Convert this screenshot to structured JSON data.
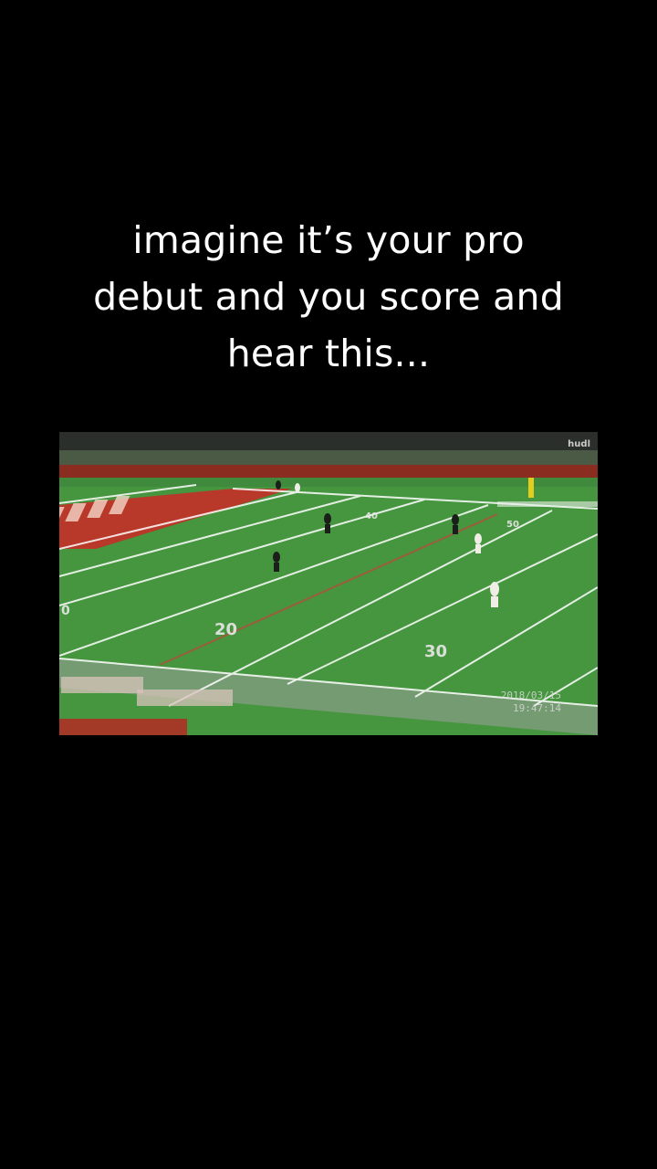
{
  "caption": {
    "line1": "imagine it’s your pro",
    "line2": "debut and you score and",
    "line3": "hear this..."
  },
  "video": {
    "watermark": "hudl",
    "date": "2018/03/15",
    "time": "19:47:14",
    "yard_numbers": [
      "0",
      "20",
      "30",
      "40",
      "50"
    ]
  }
}
